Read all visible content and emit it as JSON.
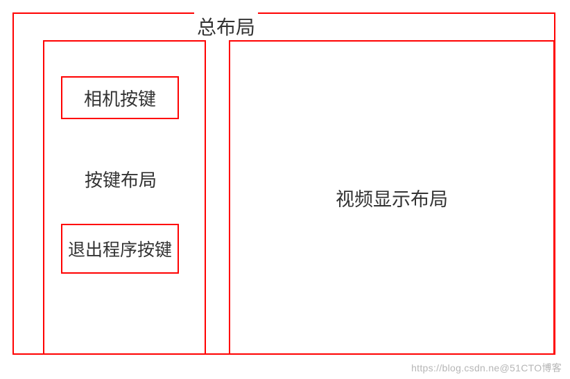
{
  "layout": {
    "title": "总布局",
    "left": {
      "camera_button": "相机按键",
      "label": "按键布局",
      "exit_button": "退出程序按键"
    },
    "right": {
      "label": "视频显示布局"
    }
  },
  "watermark": "https://blog.csdn.ne@51CTO博客"
}
